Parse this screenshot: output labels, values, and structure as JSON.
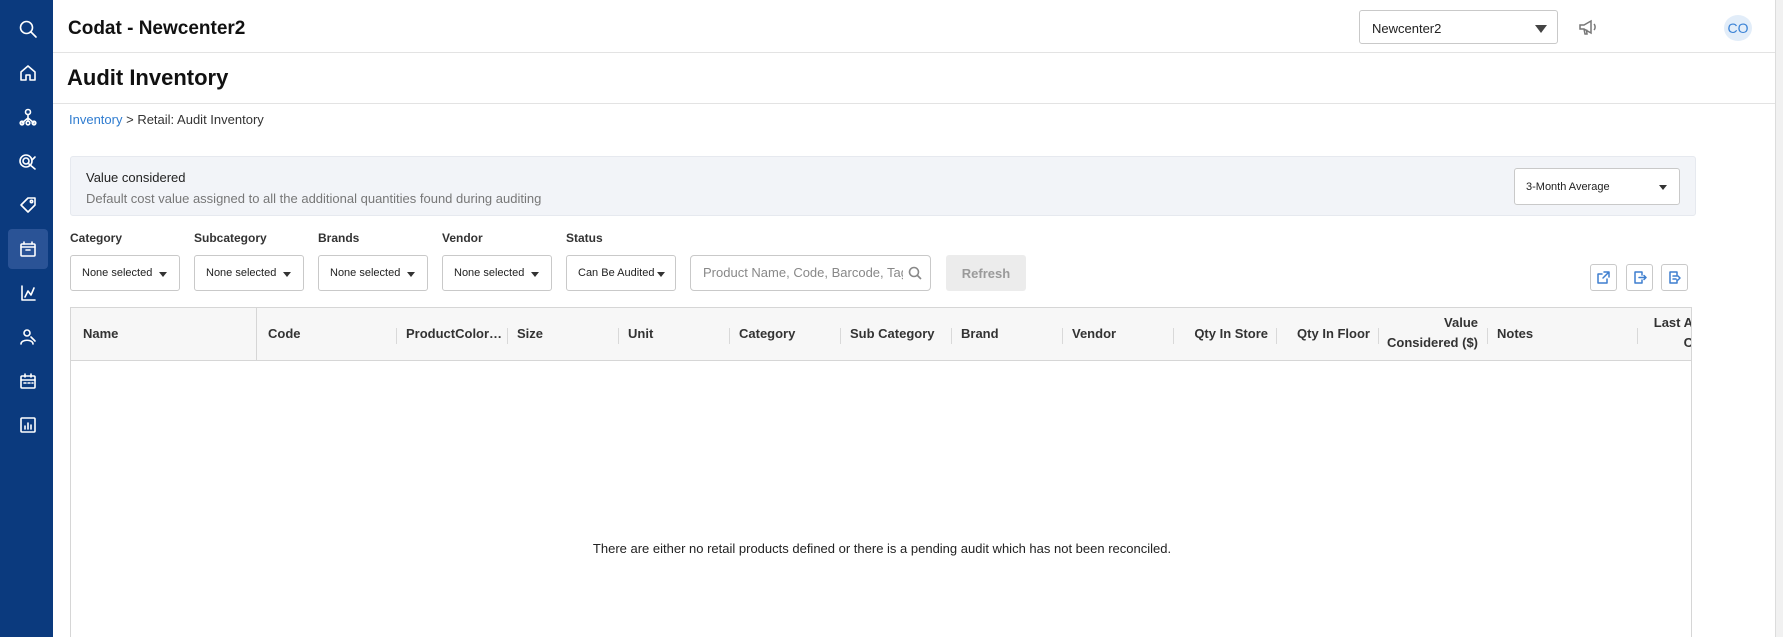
{
  "header": {
    "app_title": "Codat - Newcenter2",
    "location": "Newcenter2",
    "avatar_initials": "CO"
  },
  "page": {
    "title": "Audit Inventory"
  },
  "breadcrumb": {
    "link": "Inventory",
    "current": "> Retail: Audit Inventory"
  },
  "value_considered": {
    "title": "Value considered",
    "description": "Default cost value assigned to all the additional quantities found during auditing",
    "selected": "3-Month Average"
  },
  "filters": {
    "category": {
      "label": "Category",
      "value": "None selected"
    },
    "subcategory": {
      "label": "Subcategory",
      "value": "None selected"
    },
    "brands": {
      "label": "Brands",
      "value": "None selected"
    },
    "vendor": {
      "label": "Vendor",
      "value": "None selected"
    },
    "status": {
      "label": "Status",
      "value": "Can Be Audited"
    }
  },
  "search": {
    "placeholder": "Product Name, Code, Barcode, Tag"
  },
  "refresh_label": "Refresh",
  "table": {
    "columns": {
      "name": "Name",
      "code": "Code",
      "product_color": "ProductColor…",
      "size": "Size",
      "unit": "Unit",
      "category": "Category",
      "sub_category": "Sub Category",
      "brand": "Brand",
      "vendor": "Vendor",
      "qty_in_store": "Qty In Store",
      "qty_in_floor": "Qty In Floor",
      "value_considered_1": "Value",
      "value_considered_2": "Considered ($)",
      "notes": "Notes",
      "last_1": "Last A",
      "last_2": "C"
    },
    "empty_message": "There are either no retail products defined or there is a pending audit which has not been reconciled."
  },
  "sidebar": {
    "icons": [
      "search-icon",
      "home-icon",
      "network-icon",
      "marketing-icon",
      "tag-icon",
      "inventory-icon",
      "reports-icon",
      "customers-icon",
      "calendar-icon",
      "analytics-icon"
    ],
    "active": "inventory-icon",
    "bg_color": "#0b3a7e"
  },
  "colors": {
    "link": "#2f7cd0",
    "sidebar": "#0b3a7e",
    "accent_icon": "#3f7fcf"
  }
}
